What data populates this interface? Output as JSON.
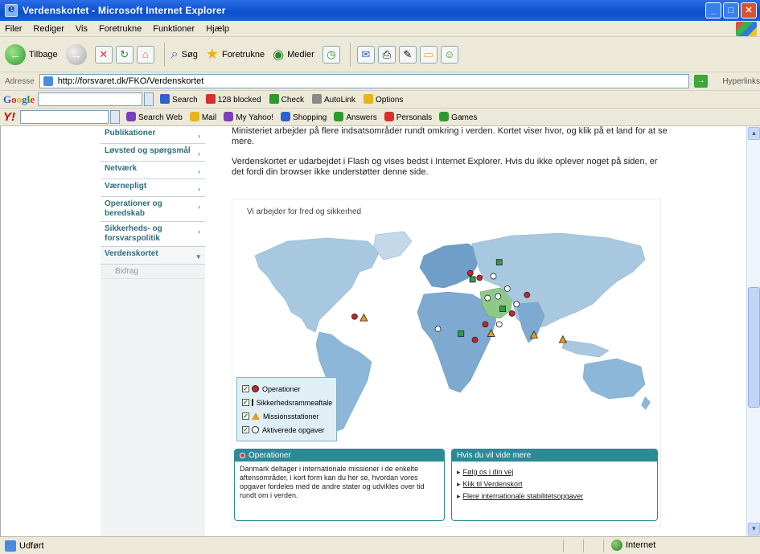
{
  "window": {
    "title": "Verdenskortet - Microsoft Internet Explorer"
  },
  "menu": [
    "Filer",
    "Rediger",
    "Vis",
    "Foretrukne",
    "Funktioner",
    "Hjælp"
  ],
  "toolbar": {
    "back": "Tilbage",
    "search": "Søg",
    "favorites": "Foretrukne",
    "media": "Medier"
  },
  "address": {
    "label": "Adresse",
    "url": "http://forsvaret.dk/FKO/Verdenskortet",
    "links": "Hyperlinks"
  },
  "google": {
    "search": "Search",
    "blocked": "128 blocked",
    "check": "Check",
    "autolink": "AutoLink",
    "options": "Options"
  },
  "yahoo": {
    "items": [
      "Search Web",
      "Mail",
      "My Yahoo!",
      "Shopping",
      "Answers",
      "Personals",
      "Games"
    ]
  },
  "nav": {
    "items": [
      {
        "label": "Publikationer"
      },
      {
        "label": "Løvsted og spørgsmål"
      },
      {
        "label": "Netværk"
      },
      {
        "label": "Værnepligt"
      },
      {
        "label": "Operationer og beredskab"
      },
      {
        "label": "Sikkerheds- og forsvarspolitik"
      },
      {
        "label": "Verdenskortet"
      }
    ],
    "sub": "Bidrag"
  },
  "intro": {
    "p1": "Ministeriet arbejder på flere indsatsområder rundt omkring i verden. Kortet viser hvor, og klik på et land for at se mere.",
    "p2": "Verdenskortet er udarbejdet i Flash og vises bedst i Internet Explorer. Hvis du ikke oplever noget på siden, er det fordi din browser ikke understøtter denne side."
  },
  "map": {
    "heading": "Vi arbejder for fred og sikkerhed",
    "colors": {
      "ocean": "#ffffff",
      "land": "#a8c8e0",
      "land_dark": "#6f9fc8",
      "highlight": "#8fc98a"
    },
    "legend": [
      "Operationer",
      "Sikkerhedsrammeaftale",
      "Missionsstationer",
      "Aktiverede opgaver"
    ],
    "markers": [
      {
        "type": "red",
        "lon": 28,
        "lat": 45
      },
      {
        "type": "green",
        "lon": 22,
        "lat": 44
      },
      {
        "type": "white",
        "lon": 44,
        "lat": 33
      },
      {
        "type": "red",
        "lon": 69,
        "lat": 34
      },
      {
        "type": "white",
        "lon": 45,
        "lat": 15
      },
      {
        "type": "red",
        "lon": 33,
        "lat": 15
      },
      {
        "type": "green",
        "lon": 48,
        "lat": 25
      },
      {
        "type": "orange",
        "lon": 75,
        "lat": 8
      },
      {
        "type": "white",
        "lon": 35,
        "lat": 32
      },
      {
        "type": "red",
        "lon": 24,
        "lat": 5
      },
      {
        "type": "white",
        "lon": -8,
        "lat": 12
      },
      {
        "type": "green",
        "lon": 12,
        "lat": 9
      },
      {
        "type": "orange",
        "lon": 38,
        "lat": 9
      },
      {
        "type": "red",
        "lon": -80,
        "lat": 20
      },
      {
        "type": "orange",
        "lon": -72,
        "lat": 19
      },
      {
        "type": "white",
        "lon": 40,
        "lat": 46
      },
      {
        "type": "red",
        "lon": 20,
        "lat": 48
      },
      {
        "type": "white",
        "lon": 60,
        "lat": 28
      },
      {
        "type": "orange",
        "lon": 100,
        "lat": 5
      },
      {
        "type": "white",
        "lon": 52,
        "lat": 38
      },
      {
        "type": "green",
        "lon": 45,
        "lat": 55
      },
      {
        "type": "red",
        "lon": 56,
        "lat": 22
      }
    ]
  },
  "panels": {
    "ops_title": "Operationer",
    "ops_text": "Danmark deltager i internationale missioner i de enkelte aftensområder, i kort form kan du her se, hvordan vores opgaver fordeles med de andre stater og udvikles over tid rundt om i verden.",
    "more_title": "Hvis du vil vide mere",
    "links": [
      "Følg os i din vej",
      "Klik til Verdenskort",
      "Flere internationale stabilitetsopgaver"
    ]
  },
  "status": {
    "left": "Udført",
    "zone": "Internet"
  }
}
